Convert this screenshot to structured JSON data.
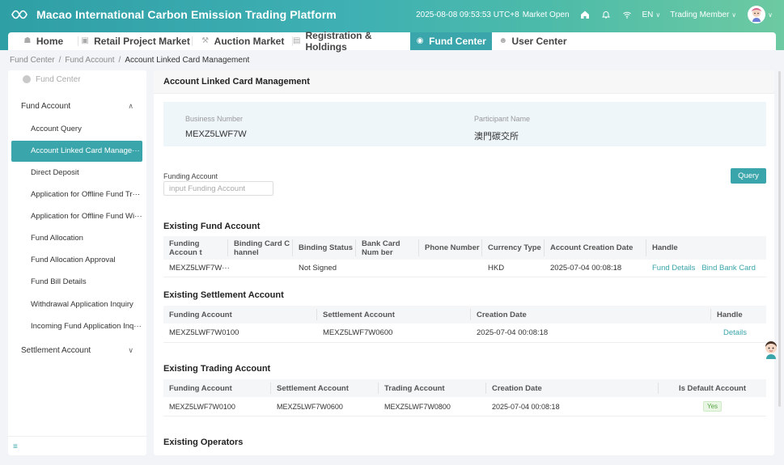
{
  "header": {
    "title": "Macao International Carbon Emission Trading Platform",
    "datetime": "2025-08-08 09:53:53 UTC+8",
    "market_status": "Market Open",
    "language": "EN",
    "user_role": "Trading Member"
  },
  "nav": {
    "tabs": [
      {
        "label": "Home",
        "icon": "home-icon"
      },
      {
        "label": "Retail Project Market",
        "icon": "store-icon"
      },
      {
        "label": "Auction Market",
        "icon": "gavel-icon"
      },
      {
        "label": "Registration & Holdings",
        "icon": "document-icon"
      },
      {
        "label": "Fund Center",
        "icon": "fund-icon",
        "active": true
      },
      {
        "label": "User Center",
        "icon": "user-icon"
      }
    ]
  },
  "breadcrumb": {
    "items": [
      "Fund Center",
      "Fund Account",
      "Account Linked Card Management"
    ]
  },
  "sidebar": {
    "header": "Fund Center",
    "groups": [
      {
        "label": "Fund Account",
        "expanded": true
      },
      {
        "label": "Settlement Account",
        "expanded": false
      }
    ],
    "items": [
      {
        "label": "Account Query"
      },
      {
        "label": "Account Linked Card Manage···",
        "active": true
      },
      {
        "label": "Direct Deposit"
      },
      {
        "label": "Application for Offline Fund Tr···"
      },
      {
        "label": "Application for Offline Fund Wi···"
      },
      {
        "label": "Fund Allocation"
      },
      {
        "label": "Fund Allocation Approval"
      },
      {
        "label": "Fund Bill Details"
      },
      {
        "label": "Withdrawal Application Inquiry"
      },
      {
        "label": "Incoming Fund Application Inq···"
      }
    ]
  },
  "main": {
    "title": "Account Linked Card Management",
    "info": {
      "business_number_label": "Business Number",
      "business_number": "MEXZ5LWF7W",
      "participant_name_label": "Participant Name",
      "participant_name": "澳門碳交所"
    },
    "filter": {
      "label": "Funding Account",
      "placeholder": "input Funding Account",
      "value": "",
      "query_label": "Query"
    },
    "fund_account": {
      "title": "Existing Fund Account",
      "headers": [
        "Funding Accoun t",
        "Binding Card C hannel",
        "Binding Status",
        "Bank Card Num ber",
        "Phone Number",
        "Currency Type",
        "Account Creation Date",
        "Handle"
      ],
      "rows": [
        {
          "funding_account": "MEXZ5LWF7W···",
          "channel": "",
          "status": "Not Signed",
          "bank_card": "",
          "phone": "",
          "currency": "HKD",
          "created": "2025-07-04 00:08:18",
          "action1": "Fund Details",
          "action2": "Bind Bank Card"
        }
      ]
    },
    "settlement_account": {
      "title": "Existing Settlement Account",
      "headers": [
        "Funding Account",
        "Settlement Account",
        "Creation Date",
        "Handle"
      ],
      "rows": [
        {
          "funding_account": "MEXZ5LWF7W0100",
          "settlement_account": "MEXZ5LWF7W0600",
          "created": "2025-07-04 00:08:18",
          "action": "Details"
        }
      ]
    },
    "trading_account": {
      "title": "Existing Trading Account",
      "headers": [
        "Funding Account",
        "Settlement Account",
        "Trading Account",
        "Creation Date",
        "Is Default Account"
      ],
      "rows": [
        {
          "funding_account": "MEXZ5LWF7W0100",
          "settlement_account": "MEXZ5LWF7W0600",
          "trading_account": "MEXZ5LWF7W0800",
          "created": "2025-07-04 00:08:18",
          "is_default": "Yes"
        }
      ]
    },
    "operators": {
      "title": "Existing Operators"
    }
  },
  "colors": {
    "accent": "#3aa5aa",
    "header_start": "#2f9fa6",
    "header_end": "#6dcaa2",
    "link": "#3aa5aa",
    "yes_tag": "#57a243"
  }
}
